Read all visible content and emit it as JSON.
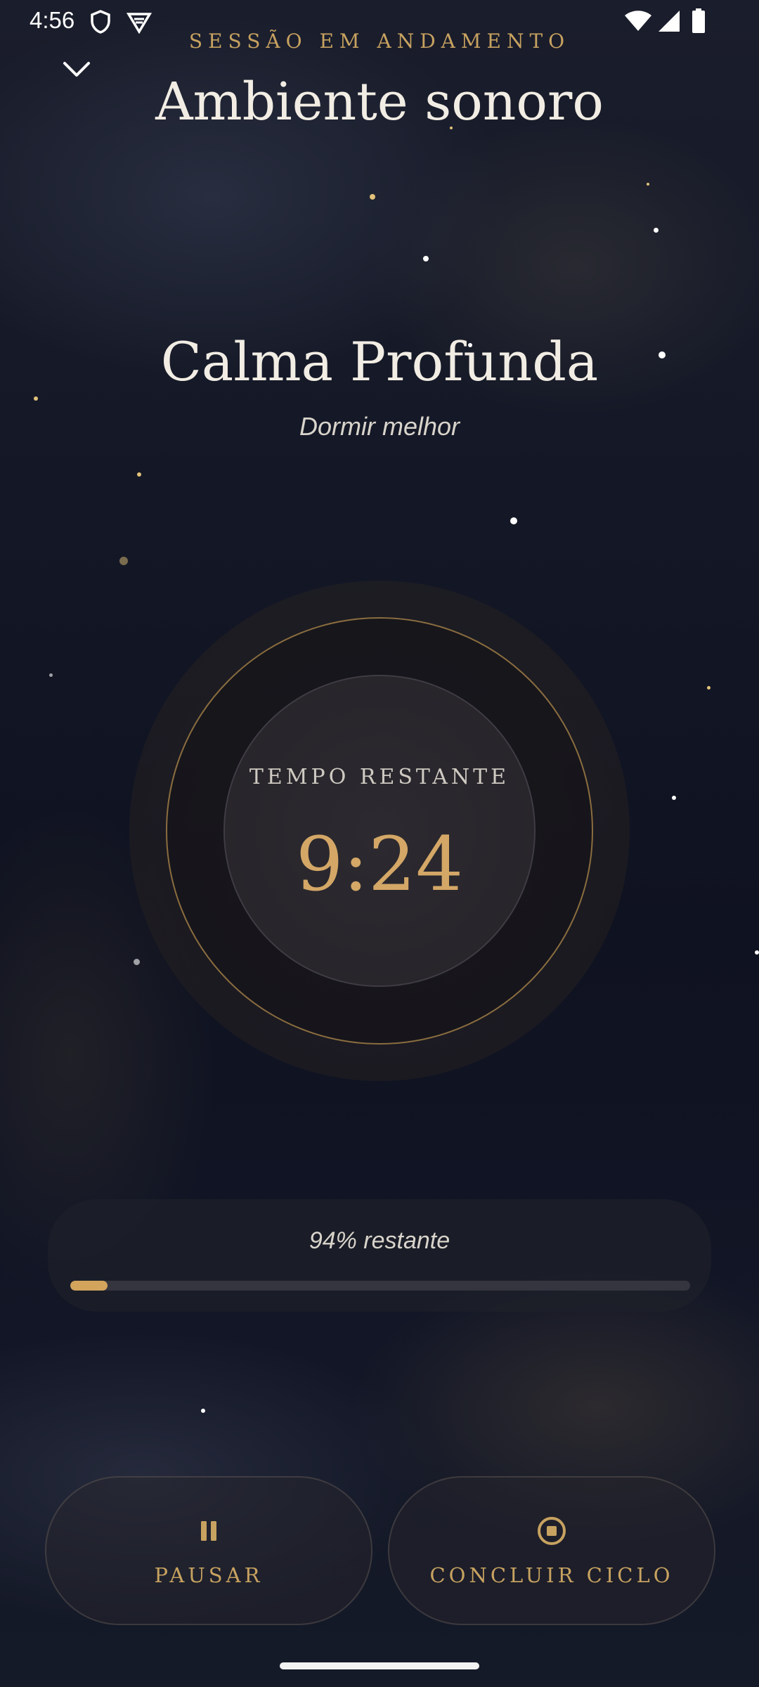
{
  "status_bar": {
    "time": "4:56",
    "icons": [
      "shield-icon",
      "vpn-icon",
      "wifi-icon",
      "signal-icon",
      "battery-icon"
    ]
  },
  "header": {
    "collapse_icon": "chevron-down-icon",
    "overline": "SESSÃO EM ANDAMENTO",
    "title": "Ambiente sonoro"
  },
  "track": {
    "title": "Calma Profunda",
    "subtitle": "Dormir melhor"
  },
  "timer": {
    "label": "TEMPO RESTANTE",
    "value": "9:24"
  },
  "progress": {
    "text": "94% restante",
    "fraction_elapsed": 0.06
  },
  "actions": {
    "pause": {
      "label": "PAUSAR",
      "icon": "pause-icon"
    },
    "stop": {
      "label": "CONCLUIR CICLO",
      "icon": "stop-icon"
    }
  },
  "colors": {
    "accent": "#c7a260",
    "timer_value": "#d4a767",
    "progress_fill": "#d2a45c"
  }
}
